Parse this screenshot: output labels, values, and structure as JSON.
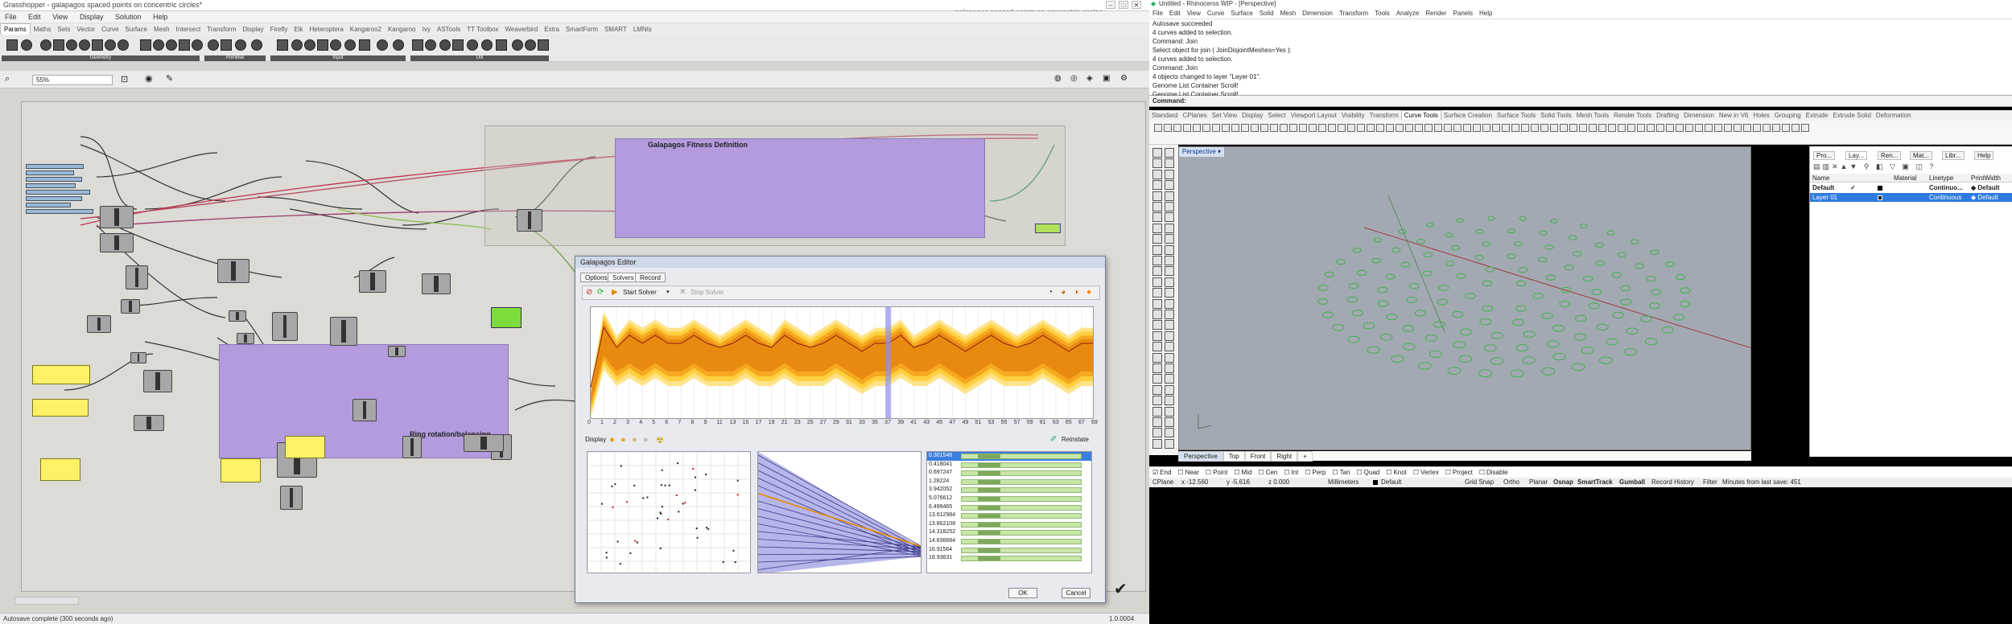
{
  "grasshopper": {
    "title": "Grasshopper - galapagos spaced points on concentric circles*",
    "doc_title": "galapagos spaced points on concentric circles",
    "menu": [
      "File",
      "Edit",
      "View",
      "Display",
      "Solution",
      "Help"
    ],
    "tabs": [
      "Params",
      "Maths",
      "Sets",
      "Vector",
      "Curve",
      "Surface",
      "Mesh",
      "Intersect",
      "Transform",
      "Display",
      "Firefly",
      "Elk",
      "Heteroptera",
      "Kangaroo2",
      "Kangaroo",
      "Ivy",
      "ASTools",
      "TT Toolbox",
      "Weaverbird",
      "Extra",
      "SmartForm",
      "SMART",
      "LMNts"
    ],
    "ribbon_groups": [
      "Geometry",
      "Primitive",
      "Input",
      "Util"
    ],
    "zoom": "55%",
    "groups": {
      "fitness": "Galapagos Fitness Definition",
      "ring": "Ring rotation/balancing"
    },
    "status": "Autosave complete (300 seconds ago)",
    "version": "1.0.0004"
  },
  "galapagos": {
    "title": "Galapagos Editor",
    "tabs": [
      "Options",
      "Solvers",
      "Record"
    ],
    "start": "Start Solver",
    "stop": "Stop Solver",
    "display_label": "Display",
    "reinstate": "Reinstate",
    "ok": "OK",
    "cancel": "Cancel",
    "axis_ticks": [
      "0",
      "1",
      "2",
      "3",
      "4",
      "5",
      "6",
      "7",
      "8",
      "9",
      "11",
      "13",
      "15",
      "17",
      "19",
      "21",
      "23",
      "25",
      "27",
      "29",
      "31",
      "33",
      "35",
      "37",
      "39",
      "41",
      "43",
      "45",
      "47",
      "49",
      "51",
      "53",
      "55",
      "57",
      "59",
      "61",
      "63",
      "65",
      "67",
      "69"
    ],
    "genomes": [
      "0.301548",
      "0.418041",
      "0.697247",
      "1.28224",
      "3.942052",
      "5.076612",
      "6.499465",
      "13.612984",
      "13.862108",
      "14.318252",
      "14.836684",
      "16.91564",
      "18.93631"
    ],
    "chart_data": {
      "type": "area",
      "title": "",
      "x": [
        0,
        1,
        2,
        3,
        4,
        5,
        6,
        7,
        8,
        9,
        11,
        13,
        15,
        17,
        19,
        21,
        23,
        25,
        27,
        29,
        31,
        33,
        35,
        37,
        39,
        41,
        43,
        45,
        47,
        49,
        51,
        53,
        55,
        57,
        59,
        61,
        63,
        65,
        67,
        69
      ],
      "series": [
        {
          "values": [
            3,
            12,
            9,
            11,
            10,
            11,
            10,
            10,
            11,
            10,
            9,
            10,
            11,
            10,
            9,
            11,
            10,
            9,
            10,
            11,
            10,
            9,
            10,
            10,
            11,
            9,
            10,
            11,
            10,
            9,
            10,
            11,
            10,
            9,
            10,
            11,
            10,
            9,
            10,
            10
          ]
        },
        {
          "values": [
            2,
            8,
            6,
            7,
            6,
            7,
            6,
            6,
            7,
            6,
            6,
            6,
            7,
            6,
            6,
            7,
            6,
            6,
            6,
            7,
            6,
            5,
            6,
            6,
            7,
            6,
            6,
            7,
            6,
            5,
            6,
            7,
            6,
            6,
            6,
            7,
            6,
            5,
            6,
            6
          ]
        }
      ],
      "ylim": [
        0,
        14
      ]
    }
  },
  "rhino": {
    "title": "Untitled - Rhinoceros WIP - [Perspective]",
    "menu": [
      "File",
      "Edit",
      "View",
      "Curve",
      "Surface",
      "Solid",
      "Mesh",
      "Dimension",
      "Transform",
      "Tools",
      "Analyze",
      "Render",
      "Panels",
      "Help"
    ],
    "history": [
      "Autosave succeeded",
      "4 curves added to selection.",
      "Command: Join",
      "Select object for join ( JoinDisjointMeshes=Yes ):",
      "4 curves added to selection.",
      "Command: Join",
      "4 objects changed to layer \"Layer 01\".",
      "Genome List Container Scroll!",
      "Genome List Container Scroll!"
    ],
    "prompt": "Command:",
    "tabs": [
      "Standard",
      "CPlanes",
      "Set View",
      "Display",
      "Select",
      "Viewport Layout",
      "Visibility",
      "Transform",
      "Curve Tools",
      "Surface Creation",
      "Surface Tools",
      "Solid Tools",
      "Mesh Tools",
      "Render Tools",
      "Drafting",
      "Dimension",
      "New in V6",
      "Holes",
      "Grouping",
      "Extrude",
      "Extrude Solid",
      "Deformation"
    ],
    "viewport_label": "Perspective",
    "viewport_tabs": [
      "Perspective",
      "Top",
      "Front",
      "Right",
      "+"
    ],
    "panel_tabs": [
      "Pro...",
      "Lay...",
      "Ren...",
      "Mat...",
      "Libr...",
      "Help"
    ],
    "layer_headers": [
      "Name",
      "Material",
      "Linetype",
      "PrintWidth"
    ],
    "layers": [
      {
        "name": "Default",
        "check": "✓",
        "linetype": "Continuo...",
        "print": "◆ Default"
      },
      {
        "name": "Layer 01",
        "check": "",
        "linetype": "Continuous",
        "print": "◆ Default"
      }
    ],
    "osnap": [
      {
        "label": "End",
        "on": true
      },
      {
        "label": "Near",
        "on": false
      },
      {
        "label": "Point",
        "on": false
      },
      {
        "label": "Mid",
        "on": false
      },
      {
        "label": "Cen",
        "on": false
      },
      {
        "label": "Int",
        "on": false
      },
      {
        "label": "Perp",
        "on": false
      },
      {
        "label": "Tan",
        "on": false
      },
      {
        "label": "Quad",
        "on": false
      },
      {
        "label": "Knot",
        "on": false
      },
      {
        "label": "Vertex",
        "on": false
      },
      {
        "label": "Project",
        "on": false
      },
      {
        "label": "Disable",
        "on": false
      }
    ],
    "status": {
      "cplane": "CPlane",
      "x": "x -12.560",
      "y": "y -5.616",
      "z": "z 0.000",
      "units": "Millimeters",
      "layer": "Default",
      "modes": [
        "Grid Snap",
        "Ortho",
        "Planar",
        "Osnap",
        "SmartTrack",
        "Gumball",
        "Record History",
        "Filter",
        "Minutes from last save: 451"
      ]
    }
  }
}
